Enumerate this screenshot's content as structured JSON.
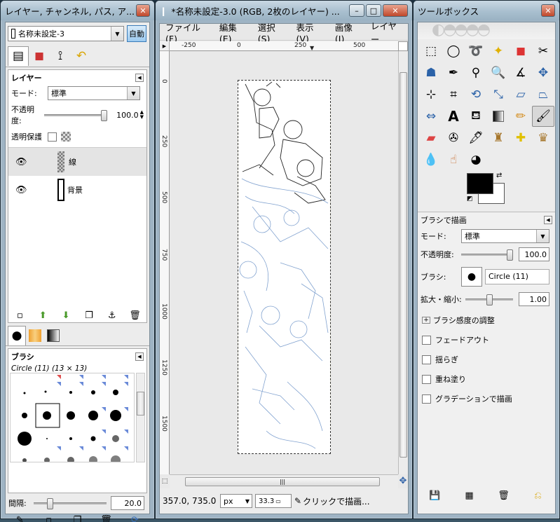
{
  "layers_window": {
    "title": "レイヤー, チャンネル, パス, ア...",
    "image_combo": "名称未設定-3",
    "auto_button": "自動",
    "layers_panel": {
      "title": "レイヤー",
      "mode_label": "モード:",
      "mode_value": "標準",
      "opacity_label": "不透明度:",
      "opacity_value": "100.0",
      "opacity_level": 1.0,
      "lock_label": "透明保護",
      "layers": [
        {
          "name": "線"
        },
        {
          "name": "背景"
        }
      ]
    },
    "brushes_panel": {
      "title": "ブラシ",
      "brush_name": "Circle (11) (13 × 13)",
      "spacing_label": "間隔:",
      "spacing_value": "20.0",
      "spacing_level": 0.2
    }
  },
  "image_window": {
    "title": "*名称未設定-3.0 (RGB, 2枚のレイヤー) ...",
    "menu": [
      "ファイル(F)",
      "編集(E)",
      "選択(S)",
      "表示(V)",
      "画像(I)",
      "レイヤー"
    ],
    "ruler_h": [
      "-250",
      "0",
      "250",
      "500"
    ],
    "ruler_v": [
      "0",
      "250",
      "500",
      "750",
      "1000",
      "1250",
      "1500"
    ],
    "coords": "357.0, 735.0",
    "unit": "px",
    "zoom": "33.3",
    "status": "クリックで描画..."
  },
  "toolbox_window": {
    "title": "ツールボックス",
    "tool_options_title": "ブラシで描画",
    "mode_label": "モード:",
    "mode_value": "標準",
    "opacity_label": "不透明度:",
    "opacity_value": "100.0",
    "opacity_level": 1.0,
    "brush_label": "ブラシ:",
    "brush_value": "Circle (11)",
    "scale_label": "拡大・縮小:",
    "scale_value": "1.00",
    "scale_level": 0.5,
    "dynamics_label": "ブラシ感度の調整",
    "options": [
      "フェードアウト",
      "揺らぎ",
      "重ね塗り",
      "グラデーションで描画"
    ],
    "colors": {
      "foreground": "#000000",
      "background": "#ffffff"
    }
  }
}
